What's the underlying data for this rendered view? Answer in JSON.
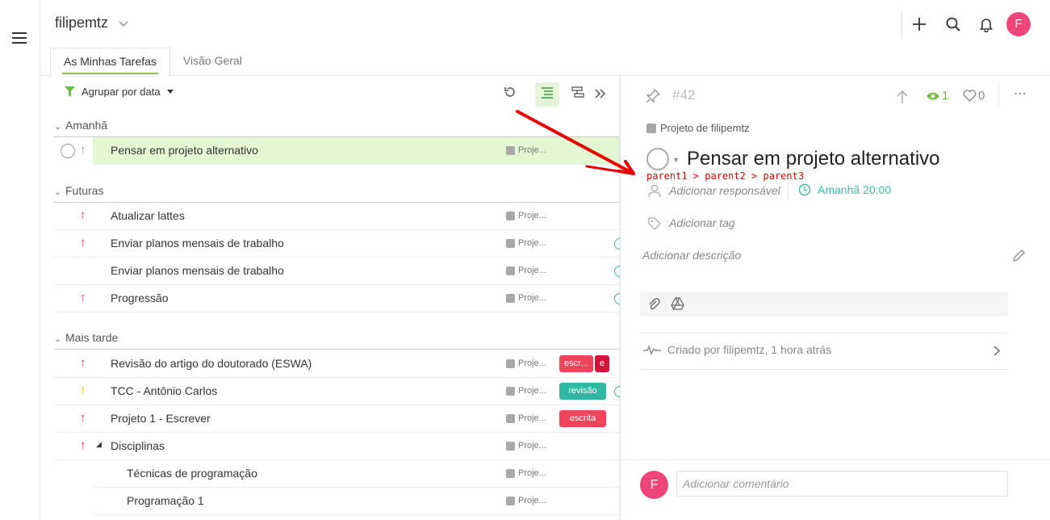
{
  "workspace": {
    "name": "filipemtz"
  },
  "tabs": [
    {
      "label": "As Minhas Tarefas",
      "active": true
    },
    {
      "label": "Visão Geral",
      "active": false
    }
  ],
  "header": {
    "avatar_letter": "F"
  },
  "toolbar": {
    "group_label": "Agrupar por data"
  },
  "sections": {
    "tomorrow": "Amanhã",
    "future": "Futuras",
    "later": "Mais tarde"
  },
  "tasks": {
    "t1": {
      "title": "Pensar em projeto alternativo",
      "project": "Proje..."
    },
    "t2": {
      "title": "Atualizar lattes",
      "project": "Proje..."
    },
    "t3": {
      "title": "Enviar planos mensais de trabalho",
      "project": "Proje..."
    },
    "t4": {
      "title": "Enviar planos mensais de trabalho",
      "project": "Proje..."
    },
    "t5": {
      "title": "Progressão",
      "project": "Proje..."
    },
    "t6": {
      "title": "Revisão do artigo do doutorado (ESWA)",
      "project": "Proje...",
      "tag1": "escr...",
      "tag2": "e"
    },
    "t7": {
      "title": "TCC - Antônio Carlos",
      "project": "Proje...",
      "tag1": "revisão"
    },
    "t8": {
      "title": "Projeto 1 - Escrever",
      "project": "Proje...",
      "tag1": "escrita"
    },
    "t9": {
      "title": "Disciplinas",
      "project": "Proje..."
    },
    "t10": {
      "title": "Técnicas de programação",
      "project": "Proje..."
    },
    "t11": {
      "title": "Programação 1",
      "project": "Proje..."
    }
  },
  "detail": {
    "task_number": "#42",
    "watchers": "1",
    "likes": "0",
    "project": "Projeto de filipemtz",
    "title": "Pensar em projeto alternativo",
    "breadcrumb": "parent1 > parent2 > parent3",
    "assignee_placeholder": "Adicionar responsável",
    "due_day": "Amanhã",
    "due_time": "20:00",
    "tag_placeholder": "Adicionar tag",
    "description_placeholder": "Adicionar descrição",
    "activity": "Criado por filipemtz, 1 hora atrás",
    "comment_avatar": "F",
    "comment_placeholder": "Adicionar comentário"
  },
  "colors": {
    "accent_green": "#8bc34a",
    "priority_red": "#e53950",
    "priority_yellow": "#f0c000",
    "teal": "#3bbba5",
    "avatar_pink": "#f0457a",
    "annotation_red": "#e60000"
  }
}
